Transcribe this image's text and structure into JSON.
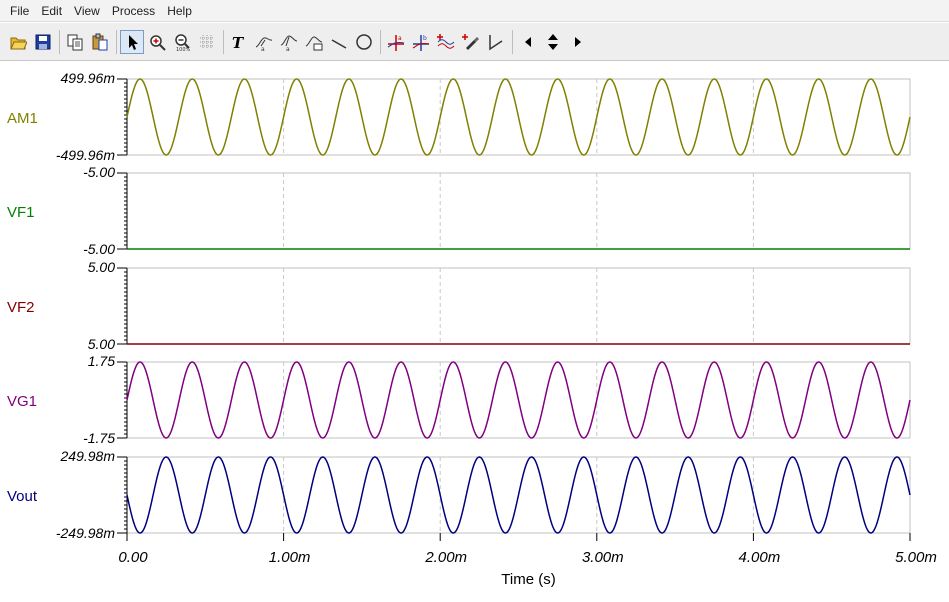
{
  "menu": [
    "File",
    "Edit",
    "View",
    "Process",
    "Help"
  ],
  "toolbar": [
    {
      "name": "open-icon"
    },
    {
      "name": "save-icon"
    },
    {
      "sep": true
    },
    {
      "name": "copy-icon"
    },
    {
      "name": "paste-icon"
    },
    {
      "sep": true
    },
    {
      "name": "pointer-icon",
      "active": true
    },
    {
      "name": "zoom-in-icon"
    },
    {
      "name": "zoom-100-icon"
    },
    {
      "name": "grid-icon"
    },
    {
      "sep": true
    },
    {
      "name": "text-icon"
    },
    {
      "name": "label-curve-icon"
    },
    {
      "name": "label-curve-alt-icon"
    },
    {
      "name": "label-curve-box-icon"
    },
    {
      "name": "line-icon"
    },
    {
      "name": "circle-icon"
    },
    {
      "sep": true
    },
    {
      "name": "cursor-a-icon"
    },
    {
      "name": "cursor-b-icon"
    },
    {
      "name": "curve-select-icon"
    },
    {
      "name": "marker-pen-icon"
    },
    {
      "name": "step-icon"
    },
    {
      "sep": true
    },
    {
      "name": "arrow-left-icon"
    },
    {
      "name": "arrow-updown-icon"
    },
    {
      "name": "arrow-right-icon"
    }
  ],
  "chart_data": {
    "type": "line",
    "xlabel": "Time (s)",
    "xlim": [
      0,
      0.005
    ],
    "x_ticks": [
      "0.00",
      "1.00m",
      "2.00m",
      "3.00m",
      "4.00m",
      "5.00m"
    ],
    "grid": true,
    "frequency_hz": 3000,
    "panels": [
      {
        "name": "AM1",
        "color": "#808000",
        "waveform": "sine",
        "amplitude": 0.49996,
        "ylim": [
          -0.49996,
          0.49996
        ],
        "y_top_label": "499.96m",
        "y_bottom_label": "-499.96m"
      },
      {
        "name": "VF1",
        "color": "#008000",
        "waveform": "constant",
        "value": -5.0,
        "ylim": [
          -5.0,
          -5.0
        ],
        "y_top_label": "-5.00",
        "y_bottom_label": "-5.00"
      },
      {
        "name": "VF2",
        "color": "#800000",
        "waveform": "constant",
        "value": 5.0,
        "ylim": [
          5.0,
          5.0
        ],
        "y_top_label": "5.00",
        "y_bottom_label": "5.00"
      },
      {
        "name": "VG1",
        "color": "#800080",
        "waveform": "sine",
        "amplitude": 1.75,
        "ylim": [
          -1.75,
          1.75
        ],
        "y_top_label": "1.75",
        "y_bottom_label": "-1.75"
      },
      {
        "name": "Vout",
        "color": "#000080",
        "waveform": "negative-sine",
        "amplitude": 0.24998,
        "ylim": [
          -0.24998,
          0.24998
        ],
        "y_top_label": "249.98m",
        "y_bottom_label": "-249.98m"
      }
    ]
  }
}
